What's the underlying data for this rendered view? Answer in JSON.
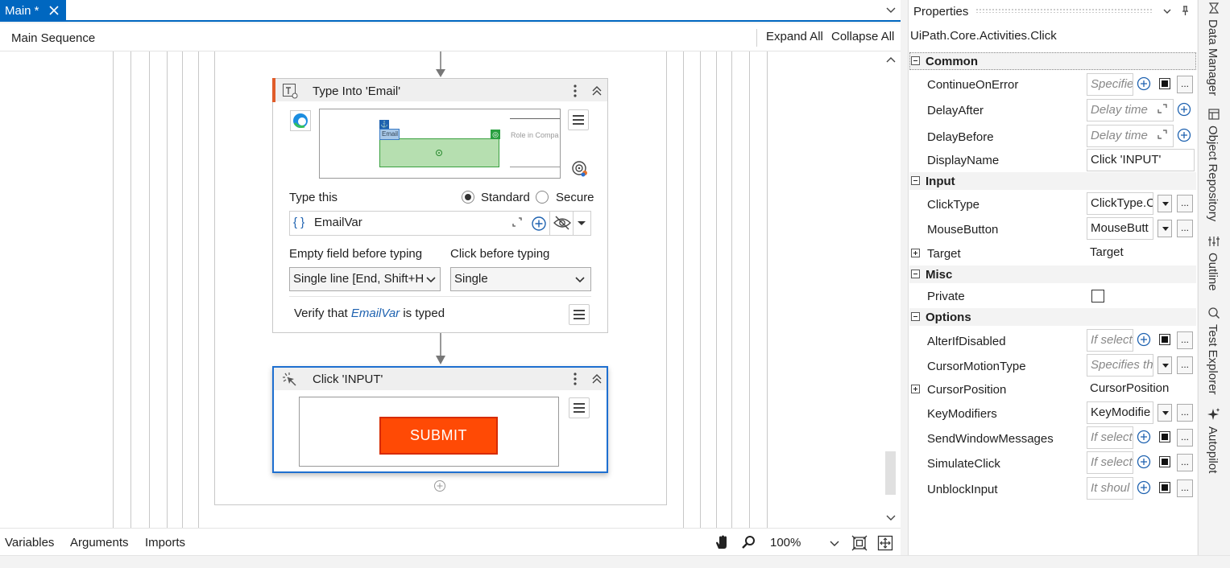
{
  "tabs": {
    "active_label": "Main *"
  },
  "designer": {
    "title": "Main Sequence",
    "expand_all": "Expand All",
    "collapse_all": "Collapse All"
  },
  "type_into": {
    "title": "Type Into 'Email'",
    "thumb_email_tag": "Email",
    "thumb_role_text": "Role in Compa",
    "type_this_label": "Type this",
    "radio_standard": "Standard",
    "radio_secure": "Secure",
    "input_value": "EmailVar",
    "empty_field_label": "Empty field before typing",
    "empty_field_value": "Single line [End, Shift+H",
    "click_before_label": "Click before typing",
    "click_before_value": "Single",
    "verify_prefix": "Verify that",
    "verify_var": "EmailVar",
    "verify_suffix": "is typed"
  },
  "click_activity": {
    "title": "Click 'INPUT'",
    "submit_label": "SUBMIT"
  },
  "bottom": {
    "variables": "Variables",
    "arguments": "Arguments",
    "imports": "Imports",
    "zoom": "100%"
  },
  "properties": {
    "title": "Properties",
    "class_name": "UiPath.Core.Activities.Click",
    "categories": {
      "common": "Common",
      "input": "Input",
      "misc": "Misc",
      "options": "Options"
    },
    "rows": {
      "continue_on_error": {
        "name": "ContinueOnError",
        "value": "Specifie"
      },
      "delay_after": {
        "name": "DelayAfter",
        "value": "Delay time"
      },
      "delay_before": {
        "name": "DelayBefore",
        "value": "Delay time"
      },
      "display_name": {
        "name": "DisplayName",
        "value": "Click 'INPUT'"
      },
      "click_type": {
        "name": "ClickType",
        "value": "ClickType.C"
      },
      "mouse_button": {
        "name": "MouseButton",
        "value": "MouseButt"
      },
      "target": {
        "name": "Target",
        "value": "Target"
      },
      "private": {
        "name": "Private"
      },
      "alter_if_disabled": {
        "name": "AlterIfDisabled",
        "value": "If select"
      },
      "cursor_motion_type": {
        "name": "CursorMotionType",
        "value": "Specifies th"
      },
      "cursor_position": {
        "name": "CursorPosition",
        "value": "CursorPosition"
      },
      "key_modifiers": {
        "name": "KeyModifiers",
        "value": "KeyModifie"
      },
      "send_window_messages": {
        "name": "SendWindowMessages",
        "value": "If select"
      },
      "simulate_click": {
        "name": "SimulateClick",
        "value": "If select"
      },
      "unblock_input": {
        "name": "UnblockInput",
        "value": "It shoul"
      }
    },
    "ellipsis": "..."
  },
  "dock": {
    "data_manager": "Data Manager",
    "object_repository": "Object Repository",
    "outline": "Outline",
    "test_explorer": "Test Explorer",
    "autopilot": "Autopilot"
  },
  "colors": {
    "accent": "#0067c0",
    "submit": "#ff4a05",
    "selection": "#1e6fd0",
    "green_target": "#b6dfb0"
  }
}
